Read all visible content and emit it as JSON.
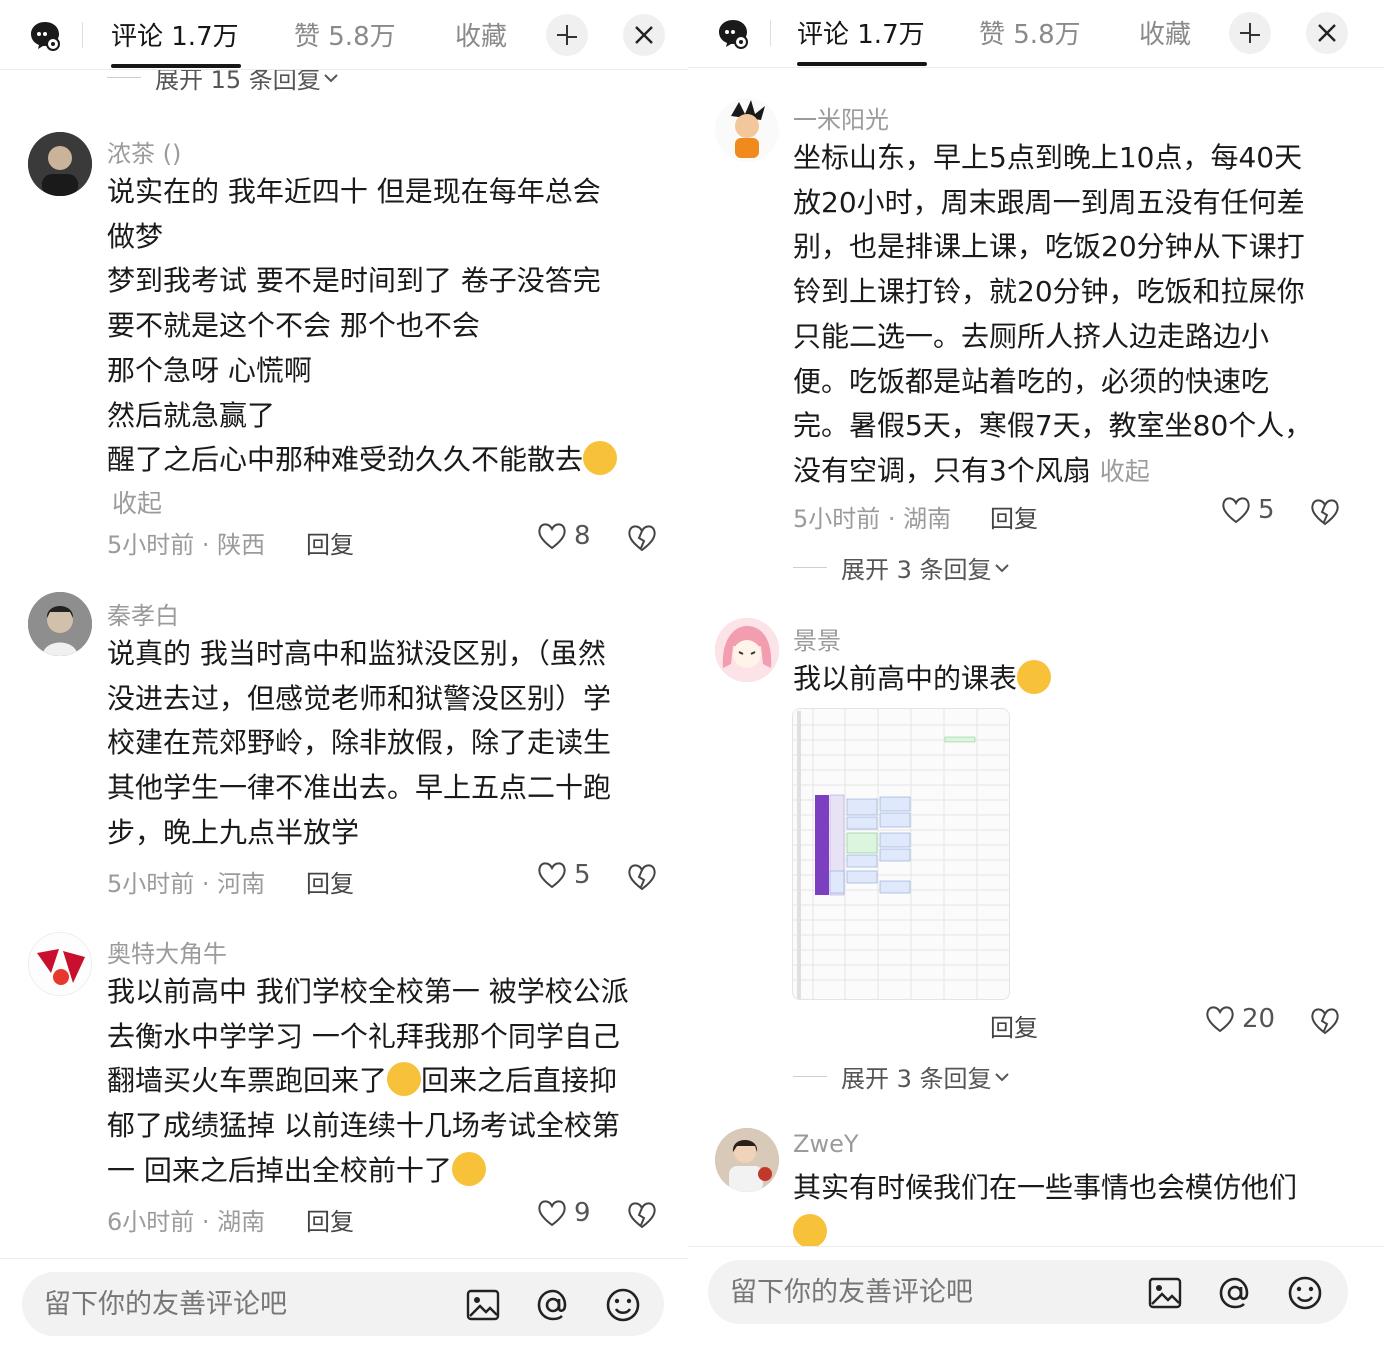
{
  "header": {
    "tab_comments": "评论 1.7万",
    "tab_likes": "赞 5.8万",
    "tab_favorites": "收藏"
  },
  "footer": {
    "placeholder": "留下你的友善评论吧"
  },
  "left": {
    "partial_expand": "展开 15 条回复",
    "comments": [
      {
        "username": "浓茶 ()",
        "text": "说实在的  我年近四十  但是现在每年总会\n做梦\n梦到我考试  要不是时间到了 卷子没答完\n要不就是这个不会 那个也不会\n那个急呀 心慌啊\n然后就急赢了\n醒了之后心中那种难受劲久久不能散去",
        "collapse": "收起",
        "time_location": "5小时前 · 陕西",
        "reply": "回复",
        "likes": "8"
      },
      {
        "username": "秦孝白",
        "text": "说真的 我当时高中和监狱没区别，（虽然\n没进去过，但感觉老师和狱警没区别）学\n校建在荒郊野岭，除非放假，除了走读生\n其他学生一律不准出去。早上五点二十跑\n步，晚上九点半放学",
        "time_location": "5小时前 · 河南",
        "reply": "回复",
        "likes": "5"
      },
      {
        "username": "奥特大角牛",
        "text_before": "我以前高中 我们学校全校第一 被学校公派\n去衡水中学学习 一个礼拜我那个同学自己\n翻墙买火车票跑回来了",
        "text_mid": "回来之后直接抑\n郁了成绩猛掉 以前连续十几场考试全校第\n一 回来之后掉出全校前十了",
        "time_location": "6小时前 · 湖南",
        "reply": "回复",
        "likes": "9"
      }
    ]
  },
  "right": {
    "comments": [
      {
        "username": "一米阳光",
        "text": "坐标山东，早上5点到晚上10点，每40天\n放20小时，周末跟周一到周五没有任何差\n别，也是排课上课，吃饭20分钟从下课打\n铃到上课打铃，就20分钟，吃饭和拉屎你\n只能二选一。去厕所人挤人边走路边小\n便。吃饭都是站着吃的，必须的快速吃\n完。暑假5天，寒假7天，教室坐80个人，\n没有空调，只有3个风扇 ",
        "collapse": "收起",
        "time_location": "5小时前 · 湖南",
        "reply": "回复",
        "likes": "5",
        "expand": "展开 3 条回复"
      },
      {
        "username": "景景",
        "text": "我以前高中的课表",
        "reply": "回复",
        "likes": "20",
        "expand": "展开 3 条回复"
      },
      {
        "username": "ZweY",
        "text": "其实有时候我们在一些事情也会模仿他们"
      }
    ]
  },
  "colors": {
    "accent": "#161616",
    "muted": "#9b9b9b",
    "schedule_purple": "#7b3fbf"
  }
}
